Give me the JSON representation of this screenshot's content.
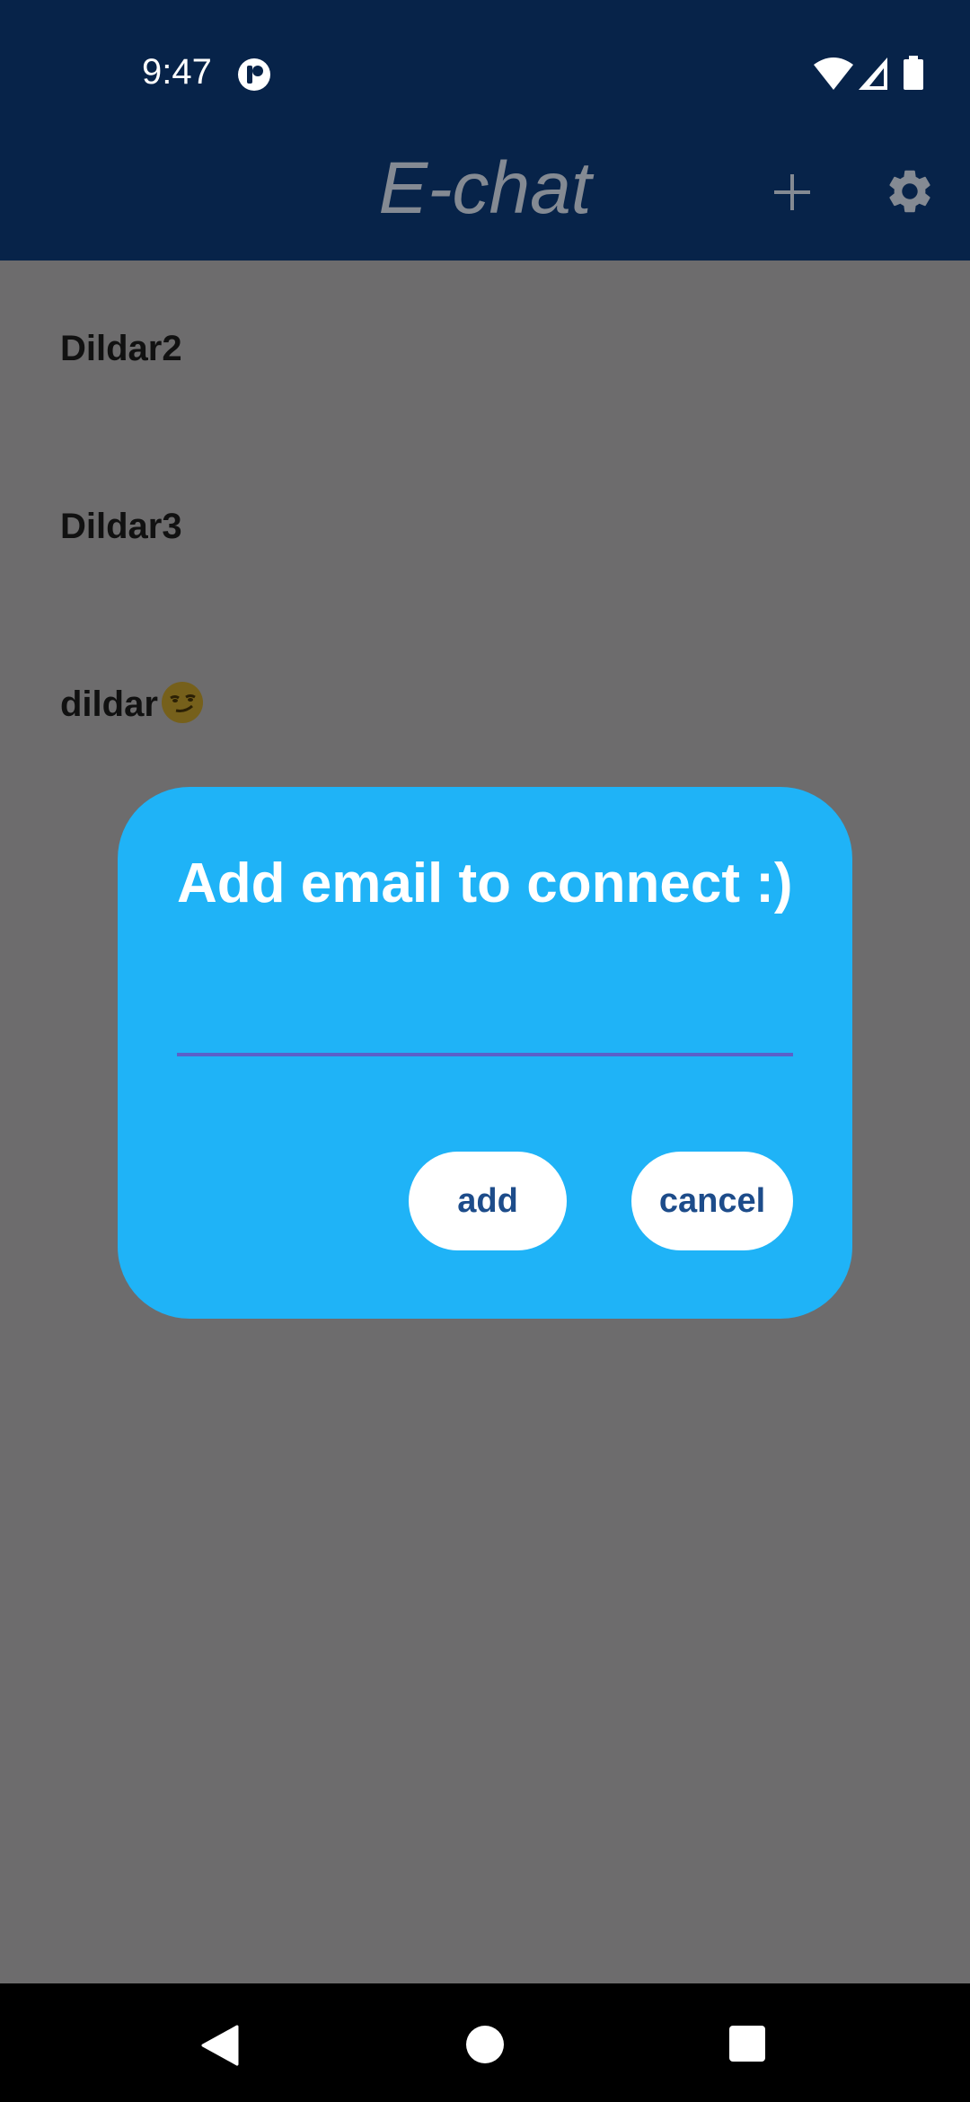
{
  "status_bar": {
    "time": "9:47",
    "icons": [
      "notification-icon",
      "wifi-icon",
      "signal-icon",
      "battery-icon"
    ]
  },
  "app_bar": {
    "title": "E-chat",
    "actions": [
      "add-icon",
      "gear-icon"
    ]
  },
  "chats": [
    {
      "name": "Dildar2",
      "emoji": ""
    },
    {
      "name": "Dildar3",
      "emoji": ""
    },
    {
      "name": "dildar",
      "emoji": "smirking-face-icon"
    }
  ],
  "dialog": {
    "title": "Add email to connect :)",
    "email_value": "",
    "email_placeholder": "",
    "add_label": "add",
    "cancel_label": "cancel"
  },
  "nav_bar": {
    "buttons": [
      "back-icon",
      "home-icon",
      "recents-icon"
    ]
  },
  "colors": {
    "status_bg": "#072349",
    "scrim": "#6d6c6d",
    "dialog_bg": "#1fb3f7",
    "button_text": "#1d4c8a",
    "input_underline": "#5b60c9"
  }
}
